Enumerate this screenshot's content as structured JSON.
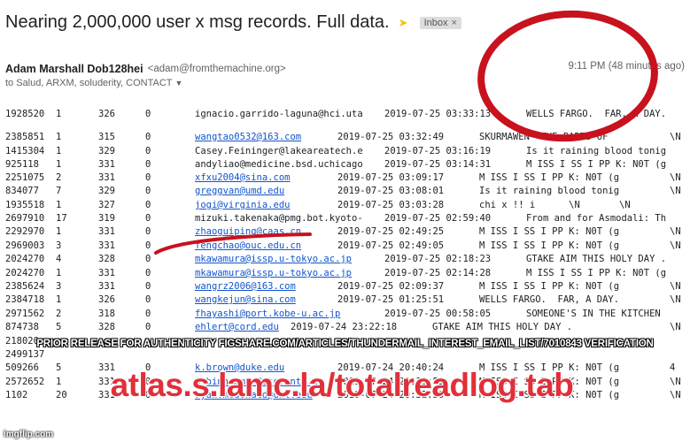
{
  "subject": "Nearing 2,000,000 user x msg records. Full data.",
  "label": "Inbox",
  "label_remove": "×",
  "sender": {
    "name": "Adam Marshall Dob128hei",
    "email": "<adam@fromthemachine.org>"
  },
  "time": "9:11 PM (48 minutes ago)",
  "recipients": "to Salud, ARXM, soluderity, CONTACT",
  "icons": {
    "important": "important-marker-icon",
    "expand": "chevron-down-icon",
    "remove": "close-icon"
  },
  "colors": {
    "link": "#1155cc",
    "annotation": "#c8121e",
    "watermark": "#e0303a"
  },
  "records": [
    {
      "id": "1928520",
      "a": "1",
      "b": "326",
      "c": "0",
      "email": "ignacio.garrido-laguna@hci.uta",
      "link": false,
      "ts": "2019-07-25 03:33:13",
      "shift": 1,
      "msg": "WELLS FARGO.  FAR, A DAY.",
      "n": ""
    },
    {
      "id": "2385851",
      "a": "1",
      "b": "315",
      "c": "0",
      "email": "wangtao0532@163.com",
      "link": true,
      "ts": "2019-07-25 03:32:49",
      "shift": 2,
      "msg": "SKURMAWEN  THE BARTS OF",
      "n": "\\N"
    },
    {
      "id": "1415304",
      "a": "1",
      "b": "329",
      "c": "0",
      "email": "Casey.Feininger@lakeareatech.e",
      "link": false,
      "ts": "2019-07-25 03:16:19",
      "shift": 1,
      "msg": "Is it raining blood tonig",
      "n": ""
    },
    {
      "id": "925118",
      "a": "1",
      "b": "331",
      "c": "0",
      "email": "andyliao@medicine.bsd.uchicago",
      "link": false,
      "ts": "2019-07-25 03:14:31",
      "shift": 1,
      "msg": "M ISS I SS I PP K: N0T (g",
      "n": ""
    },
    {
      "id": "2251075",
      "a": "2",
      "b": "331",
      "c": "0",
      "email": "xfxu2004@sina.com",
      "link": true,
      "ts": "2019-07-25 03:09:17",
      "shift": 2,
      "msg": "M ISS I SS I PP K: N0T (g",
      "n": "\\N"
    },
    {
      "id": "834077",
      "a": "7",
      "b": "329",
      "c": "0",
      "email": "greggvan@umd.edu",
      "link": true,
      "ts": "2019-07-25 03:08:01",
      "shift": 2,
      "msg": "Is it raining blood tonig",
      "n": "\\N"
    },
    {
      "id": "1935518",
      "a": "1",
      "b": "327",
      "c": "0",
      "email": "jogi@virginia.edu",
      "link": true,
      "ts": "2019-07-25 03:03:28",
      "shift": 2,
      "msg": "chi x !! i      \\N       \\N",
      "n": ""
    },
    {
      "id": "2697910",
      "a": "17",
      "b": "319",
      "c": "0",
      "email": "mizuki.takenaka@pmg.bot.kyoto-",
      "link": false,
      "ts": "2019-07-25 02:59:40",
      "shift": 1,
      "msg": "From and for Asmodali: Th",
      "n": ""
    },
    {
      "id": "2292970",
      "a": "1",
      "b": "331",
      "c": "0",
      "email": "zhaoguiping@caas.cn",
      "link": true,
      "ts": "2019-07-25 02:49:25",
      "shift": 2,
      "msg": "M ISS I SS I PP K: N0T (g",
      "n": "\\N"
    },
    {
      "id": "2969003",
      "a": "3",
      "b": "331",
      "c": "0",
      "email": "fengchao@ouc.edu.cn",
      "link": true,
      "ts": "2019-07-25 02:49:05",
      "shift": 2,
      "msg": "M ISS I SS I PP K: N0T (g",
      "n": "\\N"
    },
    {
      "id": "2024270",
      "a": "4",
      "b": "328",
      "c": "0",
      "email": "mkawamura@issp.u-tokyo.ac.jp",
      "link": true,
      "ts": "2019-07-25 02:18:23",
      "shift": 1,
      "msg": "GTAKE AIM THIS HOLY DAY .",
      "n": ""
    },
    {
      "id": "2024270",
      "a": "1",
      "b": "331",
      "c": "0",
      "email": "mkawamura@issp.u-tokyo.ac.jp",
      "link": true,
      "ts": "2019-07-25 02:14:28",
      "shift": 1,
      "msg": "M ISS I SS I PP K: N0T (g",
      "n": ""
    },
    {
      "id": "2385624",
      "a": "3",
      "b": "331",
      "c": "0",
      "email": "wangrz2006@163.com",
      "link": true,
      "ts": "2019-07-25 02:09:37",
      "shift": 2,
      "msg": "M ISS I SS I PP K: N0T (g",
      "n": "\\N"
    },
    {
      "id": "2384718",
      "a": "1",
      "b": "326",
      "c": "0",
      "email": "wangkejun@sina.com",
      "link": true,
      "ts": "2019-07-25 01:25:51",
      "shift": 2,
      "msg": "WELLS FARGO.  FAR, A DAY.",
      "n": "\\N"
    },
    {
      "id": "2971562",
      "a": "2",
      "b": "318",
      "c": "0",
      "email": "fhayashi@port.kobe-u.ac.jp",
      "link": true,
      "ts": "2019-07-25 00:58:05",
      "shift": 1,
      "msg": "SOMEONE'S IN THE KITCHEN",
      "n": ""
    },
    {
      "id": "874738",
      "a": "5",
      "b": "328",
      "c": "0",
      "email": "ehlert@cord.edu",
      "link": true,
      "ts": "2019-07-24 23:22:18",
      "shift": 3,
      "msg": "GTAKE AIM THIS HOLY DAY .",
      "n": "\\N"
    },
    {
      "id": "218020",
      "a": "",
      "b": "",
      "c": "",
      "email": "",
      "link": false,
      "ts": "",
      "shift": 1,
      "msg": "",
      "n": ""
    },
    {
      "id": "2499137",
      "a": "",
      "b": "",
      "c": "",
      "email": "",
      "link": false,
      "ts": "",
      "shift": 1,
      "msg": "",
      "n": ""
    },
    {
      "id": "509266",
      "a": "5",
      "b": "331",
      "c": "0",
      "email": "k.brown@duke.edu",
      "link": true,
      "ts": "2019-07-24 20:40:24",
      "shift": 2,
      "msg": "M ISS I SS I PP K: N0T (g",
      "n": "4"
    },
    {
      "id": "2572652",
      "a": "1",
      "b": "331",
      "c": "0",
      "email": "p.binhammer@utoronto.ca",
      "link": true,
      "ts": "2019-07-24 20:39:59",
      "shift": 2,
      "msg": "M ISS I SS I PP K: N0T (g",
      "n": "\\N"
    },
    {
      "id": "1102",
      "a": "20",
      "b": "331",
      "c": "0",
      "email": "ryan.mcdonald@unl.edu",
      "link": true,
      "ts": "2019-07-24 20:32:36",
      "shift": 2,
      "msg": "M ISS I SS I PP K: N0T (g",
      "n": "\\N"
    }
  ],
  "watermark_release": "PRIOR RELEASE FOR AUTHENTICITY FIGSHARE.COM/ARTICLES/THUNDERMAIL_INTEREST_EMAIL_LIST/7010843 VERIFICATION",
  "watermark_url": "atlas.s.lamc.la/totalreadlog.tab",
  "imgflip": "imgflip.com"
}
